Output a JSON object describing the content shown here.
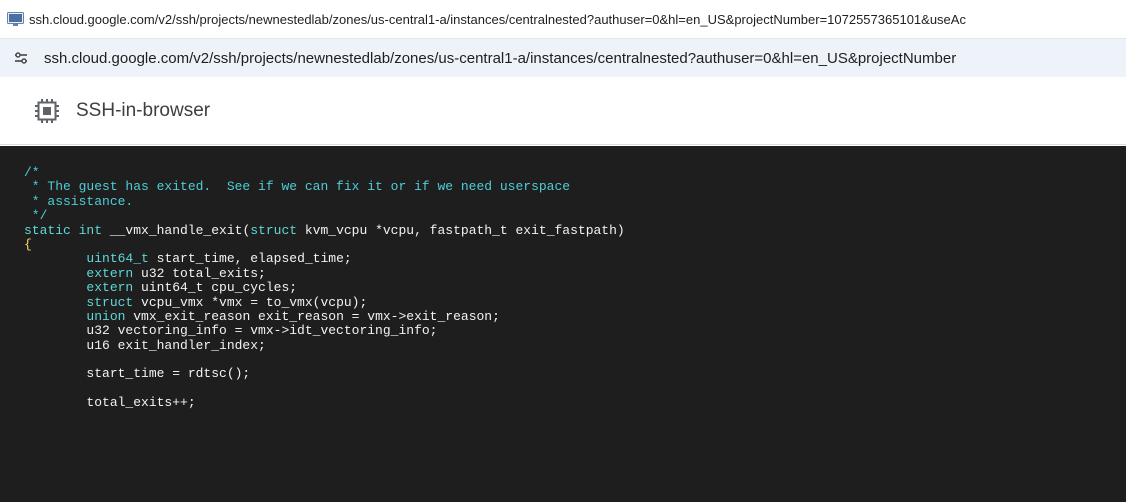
{
  "window": {
    "title": "ssh.cloud.google.com/v2/ssh/projects/newnestedlab/zones/us-central1-a/instances/centralnested?authuser=0&hl=en_US&projectNumber=1072557365101&useAc"
  },
  "address_bar": {
    "url": "ssh.cloud.google.com/v2/ssh/projects/newnestedlab/zones/us-central1-a/instances/centralnested?authuser=0&hl=en_US&projectNumber"
  },
  "header": {
    "title": "SSH-in-browser"
  },
  "terminal": {
    "lines": [
      {
        "parts": [
          {
            "t": "/*",
            "c": "comment"
          }
        ]
      },
      {
        "parts": [
          {
            "t": " * The guest has exited.  See if we can fix it or if we need userspace",
            "c": "comment"
          }
        ]
      },
      {
        "parts": [
          {
            "t": " * assistance.",
            "c": "comment"
          }
        ]
      },
      {
        "parts": [
          {
            "t": " */",
            "c": "comment"
          }
        ]
      },
      {
        "parts": [
          {
            "t": "static int",
            "c": "kw"
          },
          {
            "t": " __vmx_handle_exit(",
            "c": "plain"
          },
          {
            "t": "struct",
            "c": "kw"
          },
          {
            "t": " kvm_vcpu *vcpu, fastpath_t exit_fastpath)",
            "c": "plain"
          }
        ]
      },
      {
        "parts": [
          {
            "t": "{",
            "c": "brace"
          }
        ]
      },
      {
        "parts": [
          {
            "t": "        ",
            "c": "plain"
          },
          {
            "t": "uint64_t",
            "c": "kw"
          },
          {
            "t": " start_time, elapsed_time;",
            "c": "plain"
          }
        ]
      },
      {
        "parts": [
          {
            "t": "        ",
            "c": "plain"
          },
          {
            "t": "extern",
            "c": "kw"
          },
          {
            "t": " u32 total_exits;",
            "c": "plain"
          }
        ]
      },
      {
        "parts": [
          {
            "t": "        ",
            "c": "plain"
          },
          {
            "t": "extern",
            "c": "kw"
          },
          {
            "t": " uint64_t cpu_cycles;",
            "c": "plain"
          }
        ]
      },
      {
        "parts": [
          {
            "t": "        ",
            "c": "plain"
          },
          {
            "t": "struct",
            "c": "kw"
          },
          {
            "t": " vcpu_vmx *vmx = to_vmx(vcpu);",
            "c": "plain"
          }
        ]
      },
      {
        "parts": [
          {
            "t": "        ",
            "c": "plain"
          },
          {
            "t": "union",
            "c": "kw"
          },
          {
            "t": " vmx_exit_reason exit_reason = vmx->exit_reason;",
            "c": "plain"
          }
        ]
      },
      {
        "parts": [
          {
            "t": "        u32 vectoring_info = vmx->idt_vectoring_info;",
            "c": "plain"
          }
        ]
      },
      {
        "parts": [
          {
            "t": "        u16 exit_handler_index;",
            "c": "plain"
          }
        ]
      },
      {
        "parts": [
          {
            "t": "",
            "c": "plain"
          }
        ]
      },
      {
        "parts": [
          {
            "t": "        start_time = rdtsc();",
            "c": "plain"
          }
        ]
      },
      {
        "parts": [
          {
            "t": "",
            "c": "plain"
          }
        ]
      },
      {
        "parts": [
          {
            "t": "        total_exits++;",
            "c": "plain"
          }
        ]
      }
    ]
  },
  "icons": {
    "window_icon": "terminal-window-icon",
    "site_info_icon": "tune-icon",
    "app_icon": "chip-icon"
  },
  "colors": {
    "terminal_bg": "#1e1e1e",
    "comment": "#4ecdd7",
    "keyword": "#5fd7d7",
    "text": "#f2f2f2",
    "brace": "#ffd75f"
  }
}
